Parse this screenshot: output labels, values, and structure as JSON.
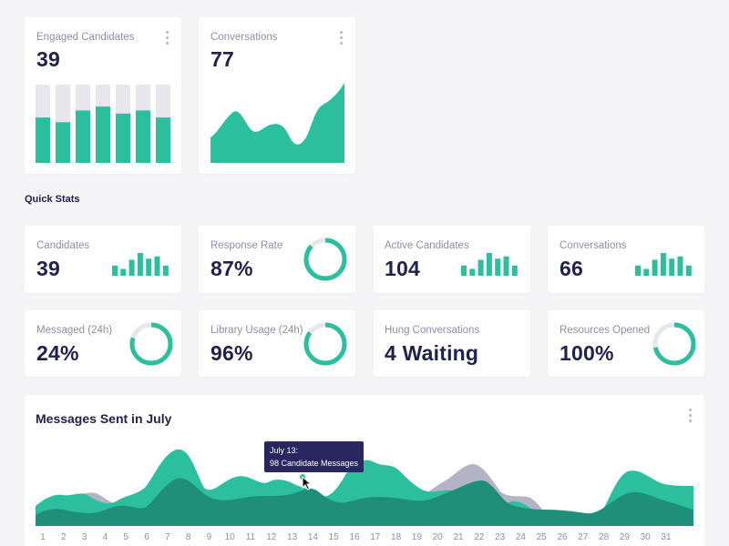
{
  "colors": {
    "accent": "#2bbf9e",
    "track": "#e6e6ec",
    "dark_area": "#1f8f7a",
    "grey_area": "#b3b2c6",
    "text_dark": "#22204d",
    "text_muted": "#8f8da6"
  },
  "top_cards": {
    "engaged": {
      "label": "Engaged Candidates",
      "value": "39",
      "bars": [
        0.58,
        0.52,
        0.67,
        0.72,
        0.63,
        0.67,
        0.58
      ]
    },
    "conversations": {
      "label": "Conversations",
      "value": "77"
    }
  },
  "quick_stats": {
    "title": "Quick Stats",
    "candidates": {
      "label": "Candidates",
      "value": "39",
      "bars": [
        0.45,
        0.3,
        0.7,
        1.0,
        0.75,
        0.85,
        0.45
      ]
    },
    "response_rate": {
      "label": "Response Rate",
      "value": "87%",
      "percent": 87
    },
    "active_candidates": {
      "label": "Active Candidates",
      "value": "104",
      "bars": [
        0.45,
        0.3,
        0.7,
        1.0,
        0.75,
        0.85,
        0.45
      ]
    },
    "conversations": {
      "label": "Conversations",
      "value": "66",
      "bars": [
        0.45,
        0.3,
        0.7,
        1.0,
        0.75,
        0.85,
        0.45
      ]
    },
    "messaged": {
      "label": "Messaged (24h)",
      "value": "24%",
      "percent": 80
    },
    "library_usage": {
      "label": "Library Usage (24h)",
      "value": "96%",
      "percent": 85
    },
    "hung_conversations": {
      "label": "Hung Conversations",
      "value": "4 Waiting"
    },
    "resources_opened": {
      "label": "Resources Opened",
      "value": "100%",
      "percent": 72
    }
  },
  "messages_chart": {
    "title": "Messages Sent in July",
    "x_ticks": [
      "1",
      "2",
      "3",
      "4",
      "5",
      "6",
      "7",
      "8",
      "9",
      "10",
      "11",
      "12",
      "13",
      "14",
      "15",
      "16",
      "17",
      "18",
      "19",
      "20",
      "21",
      "22",
      "23",
      "24",
      "25",
      "26",
      "27",
      "28",
      "29",
      "30",
      "31"
    ],
    "tooltip": {
      "line1": "July 13:",
      "line2": "98 Candidate Messages"
    }
  }
}
